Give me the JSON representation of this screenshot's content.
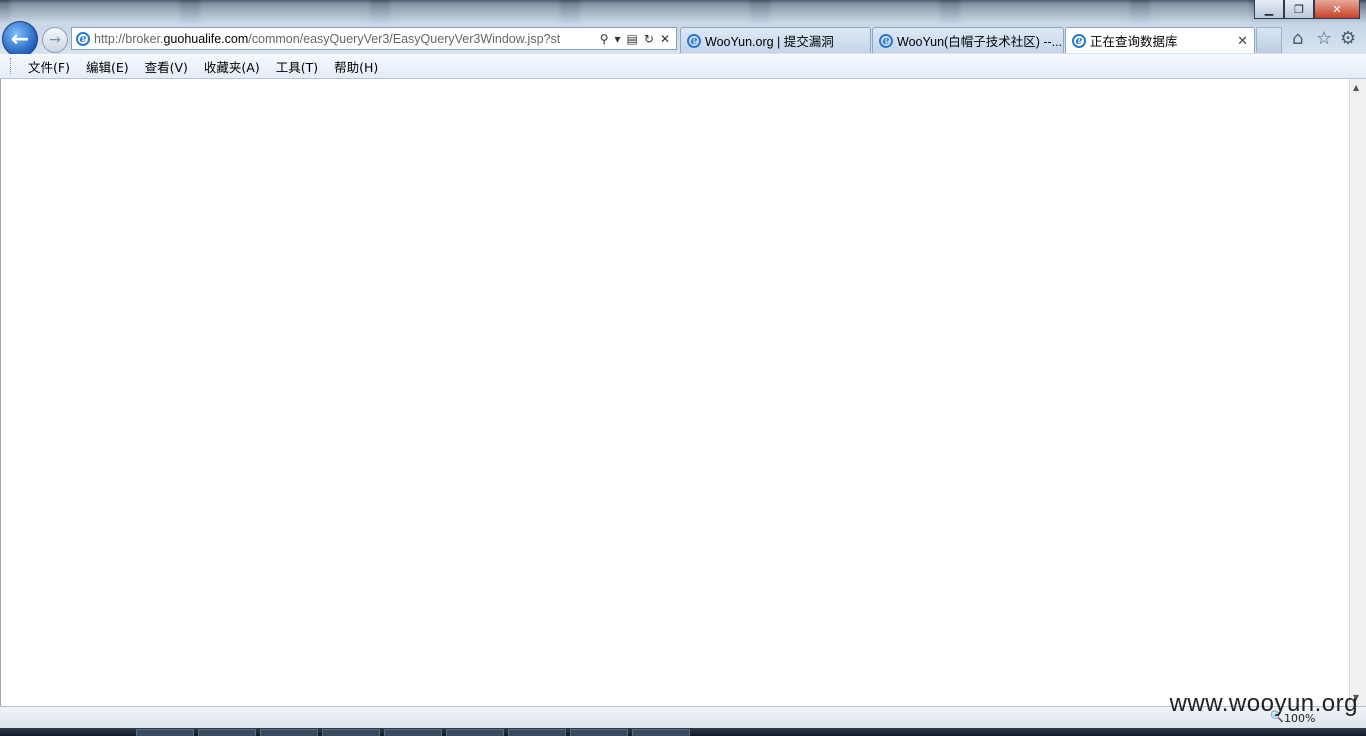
{
  "window": {
    "controls": {
      "minimize": "▁",
      "maximize": "❐",
      "close": "✕"
    }
  },
  "nav": {
    "back_icon": "back-arrow-icon",
    "forward_icon": "forward-arrow-icon"
  },
  "address": {
    "url_prefix": "http://broker.",
    "url_host": "guohualife.com",
    "url_suffix": "/common/easyQueryVer3/EasyQueryVer3Window.jsp?st",
    "icons": [
      "search-icon",
      "dropdown-icon",
      "compat-icon",
      "refresh-icon",
      "stop-icon"
    ]
  },
  "tabs": [
    {
      "label": "WooYun.org | 提交漏洞",
      "active": false
    },
    {
      "label": "WooYun(白帽子技术社区) --...",
      "active": false
    },
    {
      "label": "正在查询数据库",
      "active": true
    }
  ],
  "toolbar_icons": [
    "home-icon",
    "favorites-icon",
    "settings-icon"
  ],
  "menu": [
    {
      "label": "文件(F)"
    },
    {
      "label": "编辑(E)"
    },
    {
      "label": "查看(V)"
    },
    {
      "label": "收藏夹(A)"
    },
    {
      "label": "工具(T)"
    },
    {
      "label": "帮助(H)"
    }
  ],
  "status": {
    "zoom": "100%",
    "watermark": "www.wooyun.org"
  },
  "colors": {
    "chrome": "#d7e3f0",
    "accent": "#2a78cf",
    "close": "#c7402a"
  }
}
